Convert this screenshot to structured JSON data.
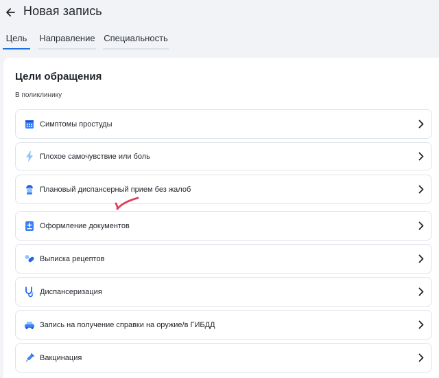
{
  "header": {
    "title": "Новая запись",
    "back_icon": "arrow-left-icon"
  },
  "tabs": [
    {
      "label": "Цель",
      "active": true
    },
    {
      "label": "Направление",
      "active": false
    },
    {
      "label": "Специальность",
      "active": false
    }
  ],
  "section": {
    "title": "Цели обращения",
    "subtitle": "В поликлинику"
  },
  "items": [
    {
      "label": "Симптомы простуды",
      "icon": "calendar-grid-icon"
    },
    {
      "label": "Плохое самочувствие или боль",
      "icon": "lightning-icon"
    },
    {
      "label": "Плановый диспансерный прием без жалоб",
      "icon": "doctor-icon"
    },
    {
      "label": "Оформление документов",
      "icon": "medical-document-icon"
    },
    {
      "label": "Выписка рецептов",
      "icon": "pills-icon"
    },
    {
      "label": "Диспансеризация",
      "icon": "stethoscope-icon"
    },
    {
      "label": "Запись на получение справки на оружие/в ГИБДД",
      "icon": "car-icon"
    },
    {
      "label": "Вакцинация",
      "icon": "syringe-icon"
    }
  ],
  "colors": {
    "accent": "#1e6fe0",
    "icon_blue": "#3b82f6",
    "checkmark": "#d9415a"
  }
}
